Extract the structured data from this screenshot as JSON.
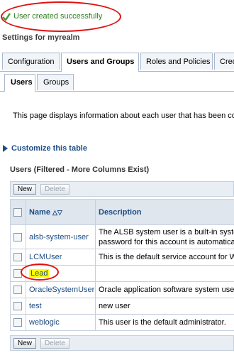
{
  "message": {
    "text": "User created successfully",
    "icon": "check-icon"
  },
  "settings_title": "Settings for myrealm",
  "tabs": [
    "Configuration",
    "Users and Groups",
    "Roles and Policies",
    "Cred"
  ],
  "subtabs": [
    "Users",
    "Groups"
  ],
  "description": "This page displays information about each user that has been co",
  "customize_label": "Customize this table",
  "table_title": "Users (Filtered - More Columns Exist)",
  "buttons": {
    "new": "New",
    "delete": "Delete"
  },
  "columns": {
    "name": "Name",
    "description": "Description"
  },
  "rows": [
    {
      "name": "alsb-system-user",
      "desc1": "The ALSB system user is a built-in syste",
      "desc2": "password for this account is automatica"
    },
    {
      "name": "LCMUser",
      "desc1": "This is the default service account for W",
      "desc2": ""
    },
    {
      "name": "Lead",
      "desc1": "",
      "desc2": ""
    },
    {
      "name": "OracleSystemUser",
      "desc1": "Oracle application software system use",
      "desc2": ""
    },
    {
      "name": "test",
      "desc1": "new user",
      "desc2": ""
    },
    {
      "name": "weblogic",
      "desc1": "This user is the default administrator.",
      "desc2": ""
    }
  ],
  "colors": {
    "accent": "#1b4c83",
    "success": "#2e7d1f",
    "annotation": "#e01010",
    "highlight": "#ffff00"
  }
}
